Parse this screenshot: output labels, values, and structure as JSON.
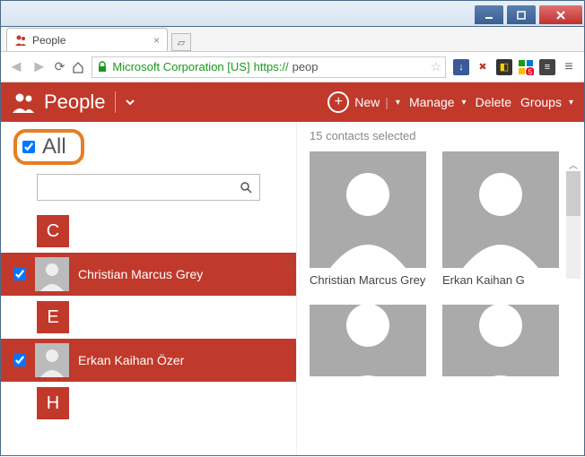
{
  "window": {
    "tab_title": "People",
    "url_ev": "Microsoft Corporation [US]",
    "url_scheme": "https://",
    "url_rest": "peop"
  },
  "header": {
    "title": "People",
    "new": "New",
    "manage": "Manage",
    "delete": "Delete",
    "groups": "Groups"
  },
  "left": {
    "all_label": "All",
    "search_placeholder": "",
    "letters": [
      "C",
      "E",
      "H"
    ],
    "contacts": [
      {
        "name": "Christian Marcus Grey"
      },
      {
        "name": "Erkan Kaihan Özer"
      }
    ]
  },
  "right": {
    "status": "15 contacts selected",
    "cards": [
      {
        "name": "Christian Marcus Grey"
      },
      {
        "name": "Erkan Kaihan G"
      }
    ]
  }
}
